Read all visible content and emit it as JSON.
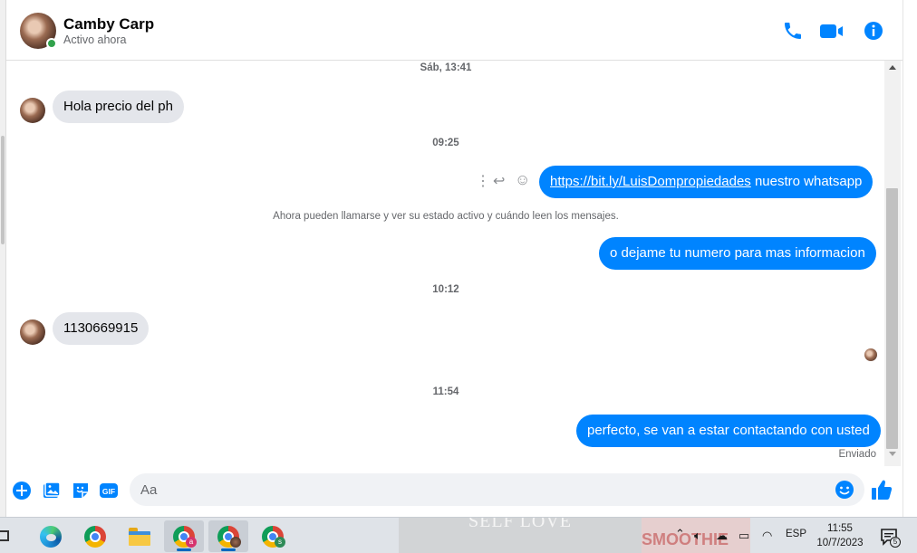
{
  "header": {
    "name": "Camby Carp",
    "status": "Activo ahora"
  },
  "chat": {
    "timestamps": [
      "Sáb, 13:41",
      "09:25",
      "10:12",
      "11:54"
    ],
    "messages": [
      {
        "dir": "in",
        "text": "Hola precio del ph"
      },
      {
        "dir": "out",
        "link": "https://bit.ly/LuisDompropiedades",
        "text": " nuestro whatsapp"
      },
      {
        "dir": "out",
        "text": "o dejame tu numero para mas informacion"
      },
      {
        "dir": "in",
        "text": "1130669915"
      },
      {
        "dir": "out",
        "text": "perfecto, se van a estar contactando con usted"
      }
    ],
    "system_note": "Ahora pueden llamarse y ver su estado activo y cuándo leen los mensajes.",
    "delivery_status": "Enviado"
  },
  "composer": {
    "placeholder": "Aa",
    "gif_label": "GIF"
  },
  "taskbar": {
    "wallpaper_text": "SELF LOVE",
    "wallpaper_text_2": "SMOOTHIE",
    "badges": [
      "a",
      "s"
    ],
    "language": "ESP",
    "time": "11:55",
    "date": "10/7/2023",
    "notification_count": "5"
  },
  "colors": {
    "accent": "#0084ff",
    "incoming_bubble": "#e4e6eb",
    "online": "#31a24c"
  }
}
